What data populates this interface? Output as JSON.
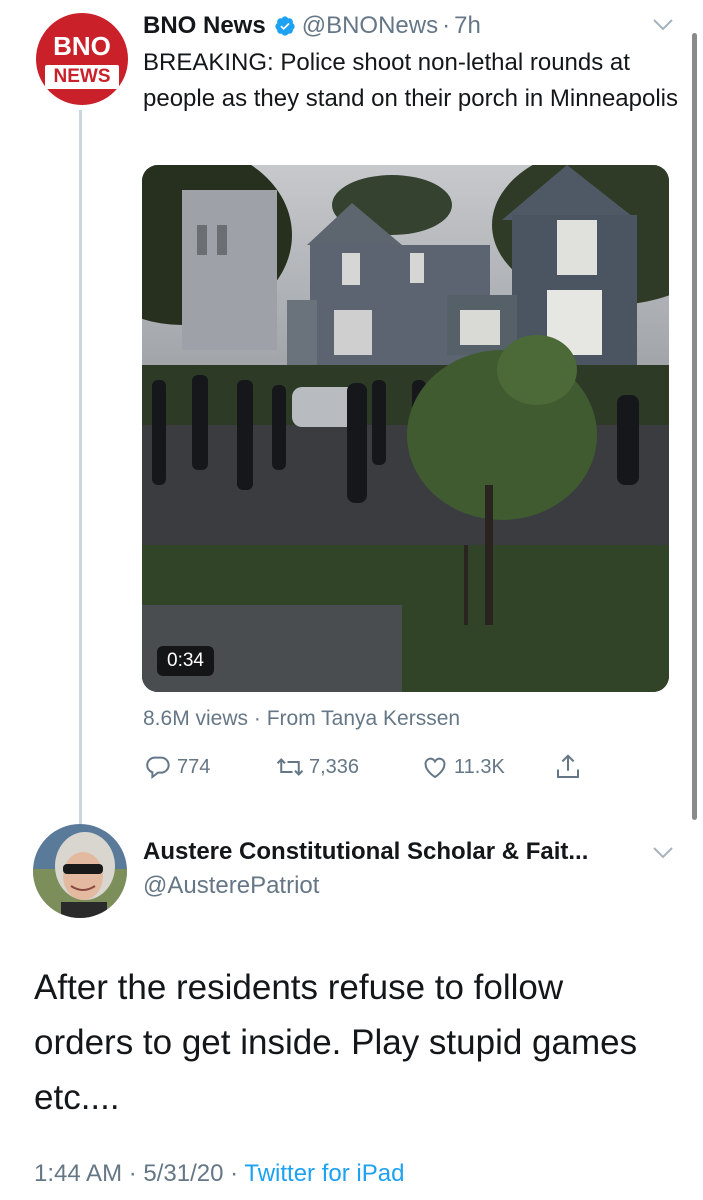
{
  "parent_tweet": {
    "avatar_text_top": "BNO",
    "avatar_text_bottom": "NEWS",
    "name": "BNO News",
    "handle": "@BNONews",
    "separator": "·",
    "time": "7h",
    "text": "BREAKING: Police shoot non-lethal rounds at people as they stand on their porch in Minneapolis",
    "video_duration": "0:34",
    "views": "8.6M views",
    "from_label": "From Tanya Kerssen",
    "replies": "774",
    "retweets": "7,336",
    "likes": "11.3K"
  },
  "main_tweet": {
    "name": "Austere Constitutional Scholar & Fait...",
    "handle": "@AusterePatriot",
    "text": "After the residents refuse to follow orders to get inside.  Play stupid games etc....",
    "time": "1:44 AM",
    "date": "5/31/20",
    "source": "Twitter for iPad"
  },
  "icons": [
    "verified-icon",
    "chevron-down-icon",
    "reply-icon",
    "retweet-icon",
    "like-icon",
    "share-icon"
  ],
  "colors": {
    "link": "#1da1f2",
    "secondary": "#657786",
    "bno_red": "#c9202a"
  }
}
